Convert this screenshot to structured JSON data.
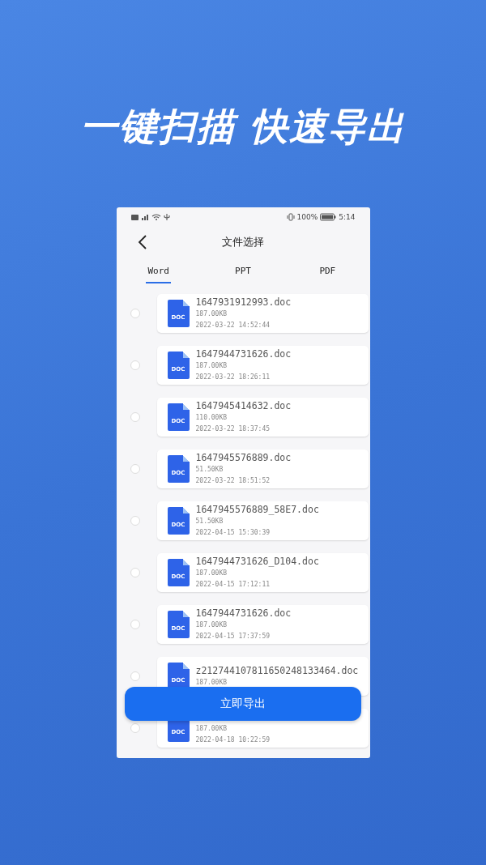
{
  "headline": "一键扫描 快速导出",
  "status_bar": {
    "battery": "100%",
    "time": "5:14"
  },
  "header": {
    "title": "文件选择"
  },
  "tabs": [
    {
      "label": "Word",
      "selected": true
    },
    {
      "label": "PPT",
      "selected": false
    },
    {
      "label": "PDF",
      "selected": false
    }
  ],
  "files": [
    {
      "icon": "DOC",
      "name": "1647931912993.doc",
      "size": "187.00KB",
      "date": "2022-03-22 14:52:44",
      "checked": false
    },
    {
      "icon": "DOC",
      "name": "1647944731626.doc",
      "size": "187.00KB",
      "date": "2022-03-22 18:26:11",
      "checked": false
    },
    {
      "icon": "DOC",
      "name": "1647945414632.doc",
      "size": "110.00KB",
      "date": "2022-03-22 18:37:45",
      "checked": false
    },
    {
      "icon": "DOC",
      "name": "1647945576889.doc",
      "size": "51.50KB",
      "date": "2022-03-22 18:51:52",
      "checked": false
    },
    {
      "icon": "DOC",
      "name": "1647945576889_58E7.doc",
      "size": "51.50KB",
      "date": "2022-04-15 15:30:39",
      "checked": false
    },
    {
      "icon": "DOC",
      "name": "1647944731626_D104.doc",
      "size": "187.00KB",
      "date": "2022-04-15 17:12:11",
      "checked": false
    },
    {
      "icon": "DOC",
      "name": "1647944731626.doc",
      "size": "187.00KB",
      "date": "2022-04-15 17:37:59",
      "checked": false
    },
    {
      "icon": "DOC",
      "name": "z212744107811650248133464.doc",
      "size": "187.00KB",
      "checked": false
    },
    {
      "icon": "DOC",
      "size": "187.00KB",
      "date": "2022-04-18 10:22:59",
      "checked": false
    }
  ],
  "export_button": "立即导出"
}
